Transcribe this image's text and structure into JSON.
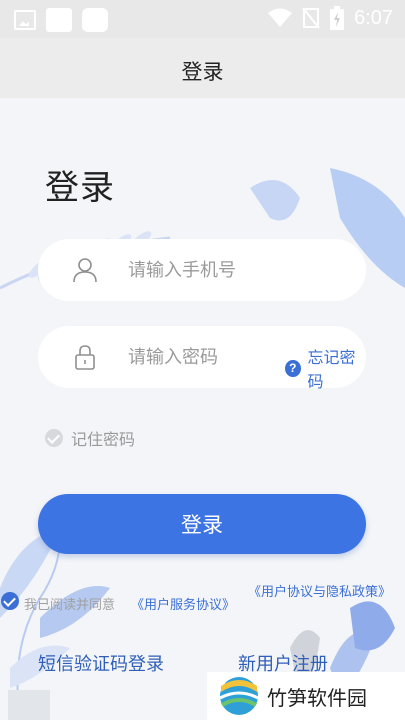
{
  "status_bar": {
    "time": "6:07"
  },
  "header": {
    "title": "登录"
  },
  "login": {
    "heading": "登录",
    "phone_placeholder": "请输入手机号",
    "password_placeholder": "请输入密码",
    "forgot_password": "忘记密码",
    "remember_password": "记住密码",
    "login_button": "登录"
  },
  "agreement": {
    "prefix": "我已阅读并同意",
    "service_agreement": "《用户服务协议》",
    "privacy_policy": "《用户协议与隐私政策》"
  },
  "footer": {
    "sms_login": "短信验证码登录",
    "register": "新用户注册"
  },
  "watermark": {
    "text": "竹笋软件园"
  },
  "colors": {
    "accent": "#3d74e3",
    "link": "#3b6fd6",
    "background": "#f3f5f8"
  }
}
